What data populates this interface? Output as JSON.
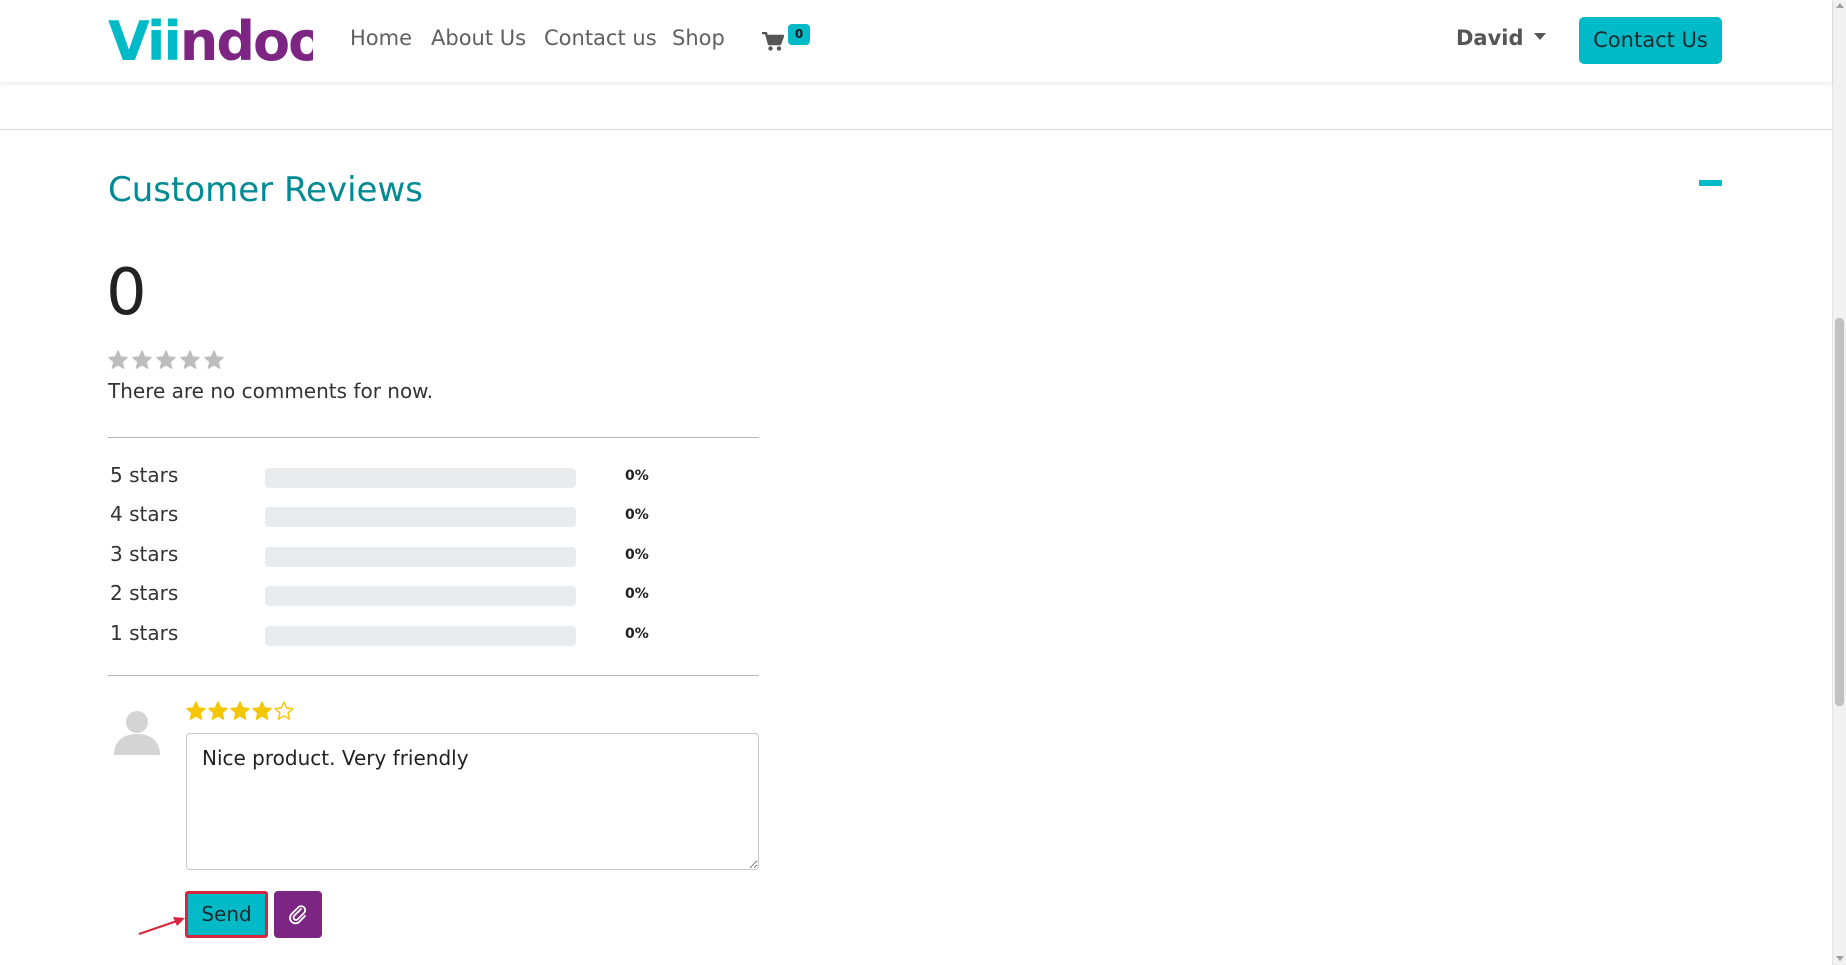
{
  "brand": {
    "name": "Viindoo",
    "colors": {
      "teal": "#00bac7",
      "teal_dark": "#008a94",
      "purple": "#7c2583",
      "star_gold": "#f3c600"
    }
  },
  "header": {
    "nav": [
      {
        "label": "Home"
      },
      {
        "label": "About Us"
      },
      {
        "label": "Contact us"
      },
      {
        "label": "Shop"
      }
    ],
    "cart": {
      "icon": "shopping-cart-icon",
      "count": "0"
    },
    "user": {
      "name": "David",
      "icon": "caret-down-icon"
    },
    "cta_label": "Contact Us"
  },
  "reviews": {
    "title": "Customer Reviews",
    "collapse_icon": "minus-icon",
    "average": "0",
    "average_stars": 0,
    "no_comments_text": "There are no comments for now.",
    "distribution": [
      {
        "label": "5 stars",
        "percent": "0%",
        "fraction": 0
      },
      {
        "label": "4 stars",
        "percent": "0%",
        "fraction": 0
      },
      {
        "label": "3 stars",
        "percent": "0%",
        "fraction": 0
      },
      {
        "label": "2 stars",
        "percent": "0%",
        "fraction": 0
      },
      {
        "label": "1 stars",
        "percent": "0%",
        "fraction": 0
      }
    ]
  },
  "composer": {
    "avatar_icon": "user-avatar-icon",
    "selected_rating": 4,
    "max_rating": 5,
    "comment_value": "Nice product. Very friendly",
    "send_label": "Send",
    "attach_icon": "paperclip-icon"
  }
}
